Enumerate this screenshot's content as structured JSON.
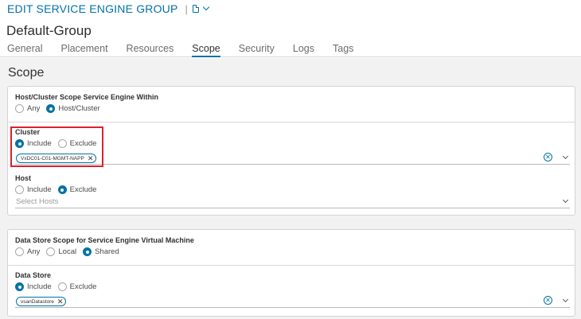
{
  "header": {
    "title": "EDIT SERVICE ENGINE GROUP",
    "separator": "|",
    "doc_icon": "document-icon",
    "menu_icon": "chevron-down-icon"
  },
  "object_name": "Default-Group",
  "tabs": [
    {
      "label": "General",
      "active": false
    },
    {
      "label": "Placement",
      "active": false
    },
    {
      "label": "Resources",
      "active": false
    },
    {
      "label": "Scope",
      "active": true
    },
    {
      "label": "Security",
      "active": false
    },
    {
      "label": "Logs",
      "active": false
    },
    {
      "label": "Tags",
      "active": false
    }
  ],
  "section_title": "Scope",
  "host_cluster_scope": {
    "label": "Host/Cluster Scope Service Engine Within",
    "options": [
      "Any",
      "Host/Cluster"
    ],
    "selected": "Host/Cluster"
  },
  "cluster": {
    "label": "Cluster",
    "options": [
      "Include",
      "Exclude"
    ],
    "selected": "Include",
    "chips": [
      "VxDC01-C01-MGMT-NAPP"
    ]
  },
  "host": {
    "label": "Host",
    "options": [
      "Include",
      "Exclude"
    ],
    "selected": "Exclude",
    "placeholder": "Select Hosts"
  },
  "datastore_scope": {
    "label": "Data Store Scope for Service Engine Virtual Machine",
    "options": [
      "Any",
      "Local",
      "Shared"
    ],
    "selected": "Shared"
  },
  "datastore": {
    "label": "Data Store",
    "options": [
      "Include",
      "Exclude"
    ],
    "selected": "Include",
    "chips": [
      "vsanDatastore"
    ]
  },
  "colors": {
    "accent": "#0072a3",
    "highlight": "#d9232e"
  }
}
